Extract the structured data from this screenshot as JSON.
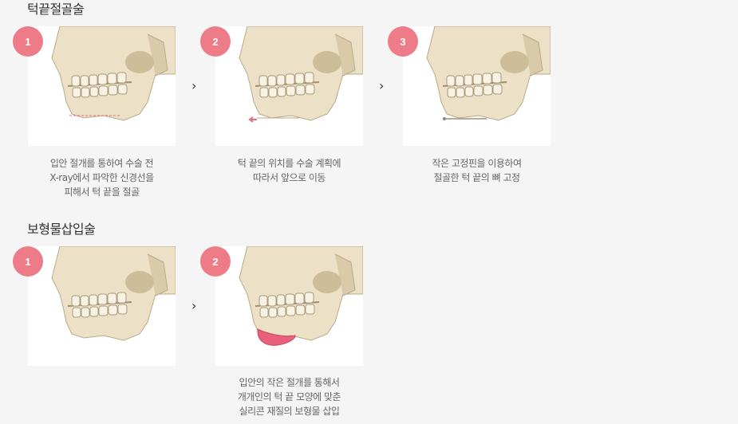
{
  "section1": {
    "title": "턱끝절골술",
    "steps": [
      {
        "number": "1",
        "caption": [
          "입안 절개를 통하여 수술 전",
          "X-ray에서 파악한 신경선을",
          "피해서 턱 끝을 절골"
        ]
      },
      {
        "number": "2",
        "caption": [
          "턱 끝의 위치를 수술 계획에",
          "따라서 앞으로 이동"
        ]
      },
      {
        "number": "3",
        "caption": [
          "작은 고정핀을 이용하여",
          "절골한 턱 끝의 뼈 고정"
        ]
      }
    ]
  },
  "section2": {
    "title": "보형물삽입술",
    "steps": [
      {
        "number": "1",
        "caption": []
      },
      {
        "number": "2",
        "caption": [
          "입안의 작은 절개를 통해서",
          "개개인의 턱 끝 모양에 맞춘",
          "실리콘 재질의 보형물 삽입"
        ]
      }
    ]
  },
  "colors": {
    "badge": "#ee7b88",
    "bone": "#ece1c6",
    "implant": "#e8607a",
    "cut_line": "#e07080"
  },
  "icons": {
    "arrow": "chevron-right-icon"
  }
}
